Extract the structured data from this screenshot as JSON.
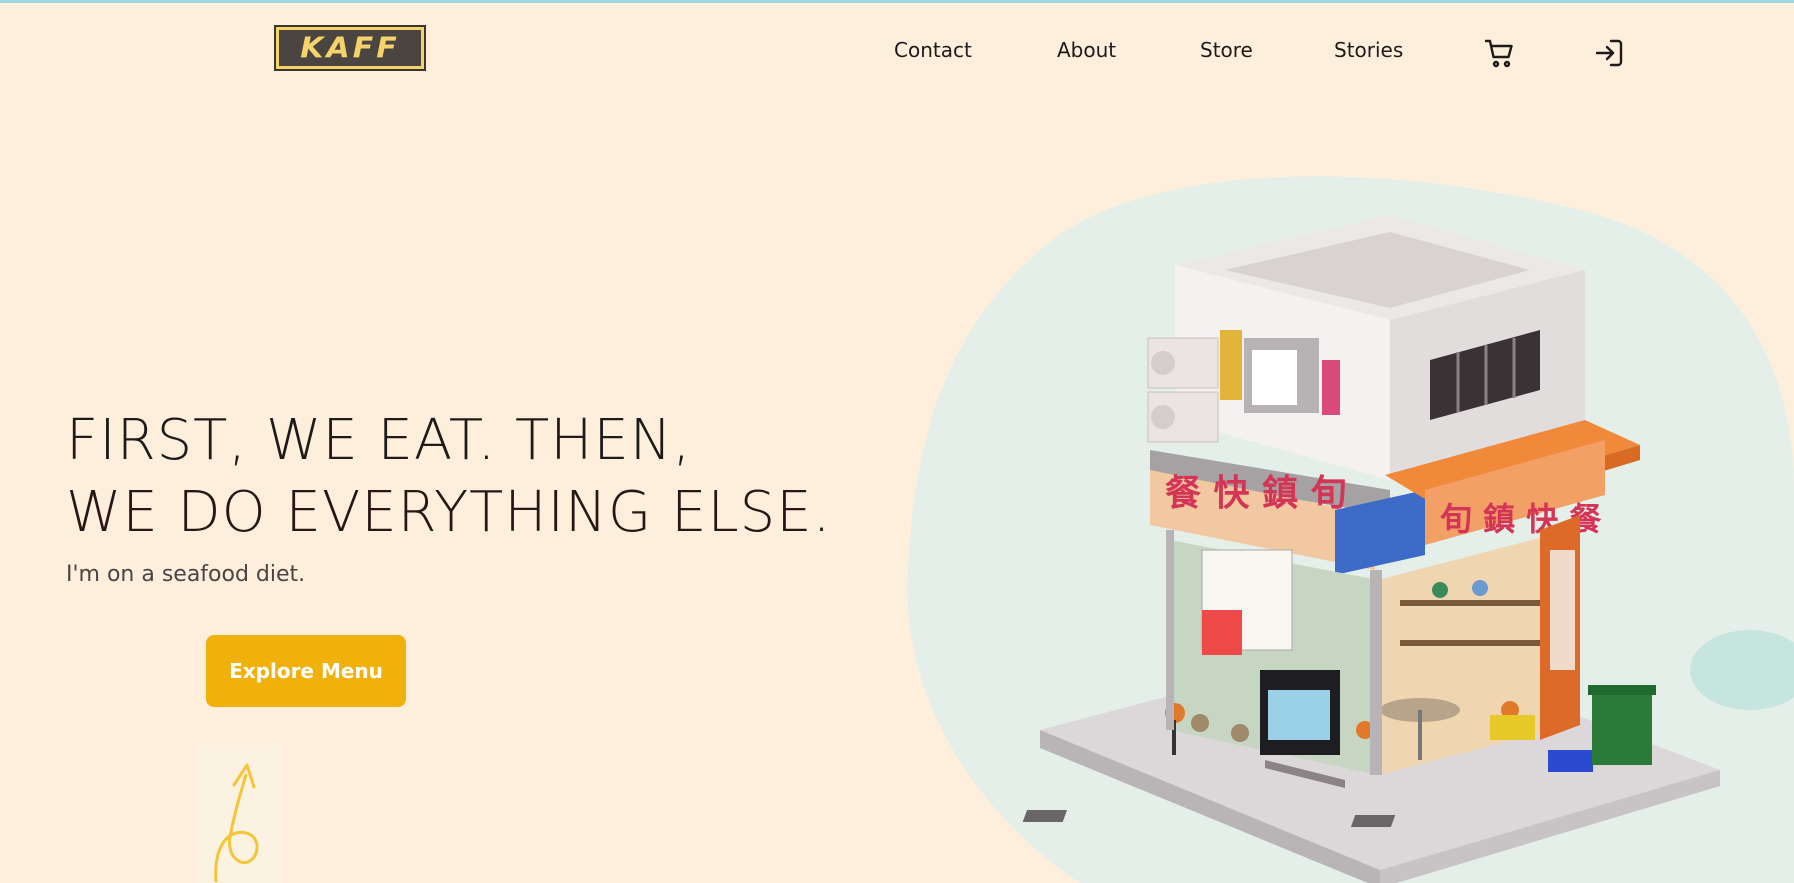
{
  "brand": {
    "logo_text": "KAFF"
  },
  "nav": {
    "items": [
      {
        "label": "Contact"
      },
      {
        "label": "About"
      },
      {
        "label": "Store"
      },
      {
        "label": "Stories"
      }
    ],
    "cart_icon": "cart-icon",
    "login_icon": "sign-in-icon"
  },
  "hero": {
    "headline_line1": "FIRST, WE EAT. THEN,",
    "headline_line2": "WE DO EVERYTHING ELSE.",
    "subtitle": "I'm on a seafood diet.",
    "cta_label": "Explore Menu",
    "doodle_icon": "curly-arrow-icon",
    "illustration": "isometric-shop-illustration"
  },
  "colors": {
    "background": "#fdefdc",
    "accent": "#f0b20a",
    "blob": "#e4efe9",
    "awning": "#f08a3a"
  }
}
